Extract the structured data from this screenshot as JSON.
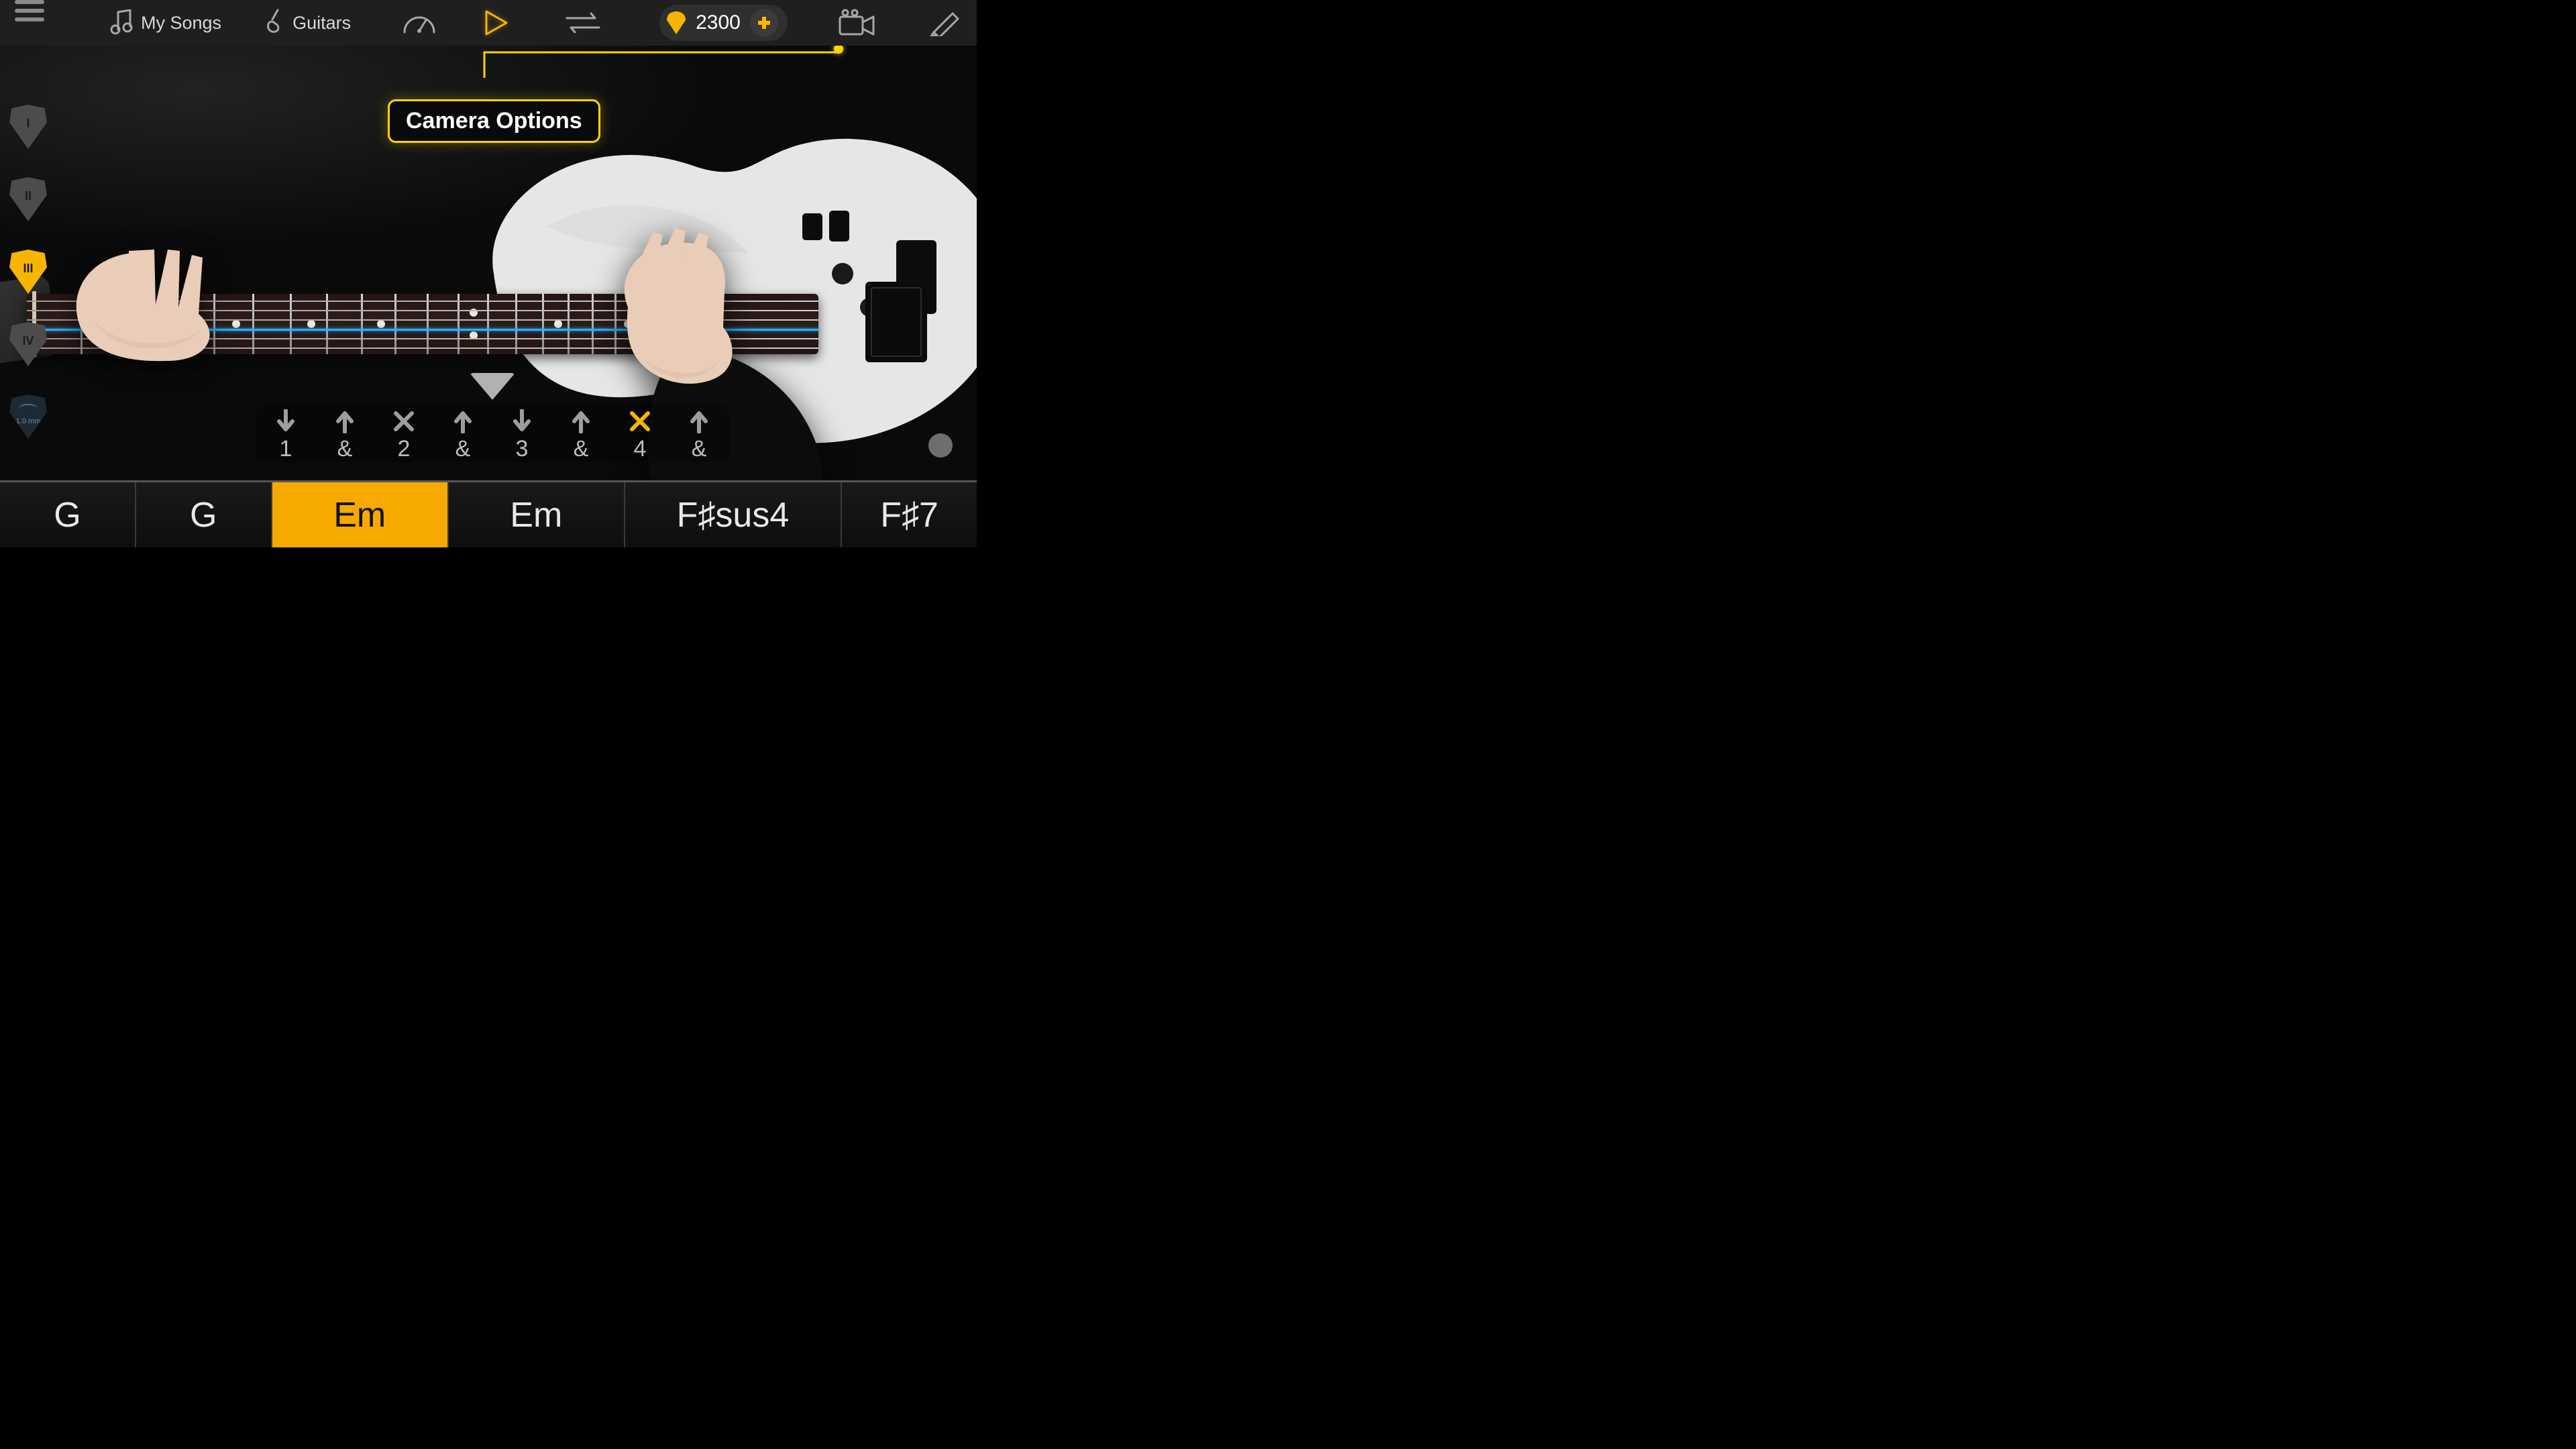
{
  "colors": {
    "accent": "#f6b500",
    "accent_bright": "#ffd400",
    "toolbar_bg": "#1f1f1f"
  },
  "toolbar": {
    "my_songs": "My Songs",
    "guitars": "Guitars",
    "coins": "2300"
  },
  "tooltip": {
    "label": "Camera Options"
  },
  "picks": [
    {
      "label": "I",
      "selected": false
    },
    {
      "label": "II",
      "selected": false
    },
    {
      "label": "III",
      "selected": true
    },
    {
      "label": "IV",
      "selected": false
    }
  ],
  "pick_detail": "1.0 mm",
  "strum": {
    "steps": [
      {
        "dir": "down",
        "beat": "1"
      },
      {
        "dir": "up",
        "beat": "&"
      },
      {
        "dir": "mute",
        "beat": "2"
      },
      {
        "dir": "up",
        "beat": "&"
      },
      {
        "dir": "down",
        "beat": "3"
      },
      {
        "dir": "up",
        "beat": "&"
      },
      {
        "dir": "mute",
        "beat": "4",
        "highlight": true
      },
      {
        "dir": "up",
        "beat": "&"
      }
    ]
  },
  "chords": [
    {
      "label": "G"
    },
    {
      "label": "G"
    },
    {
      "label": "Em",
      "active": true
    },
    {
      "label": "Em"
    },
    {
      "label": "F♯sus4"
    },
    {
      "label": "F♯7"
    }
  ]
}
